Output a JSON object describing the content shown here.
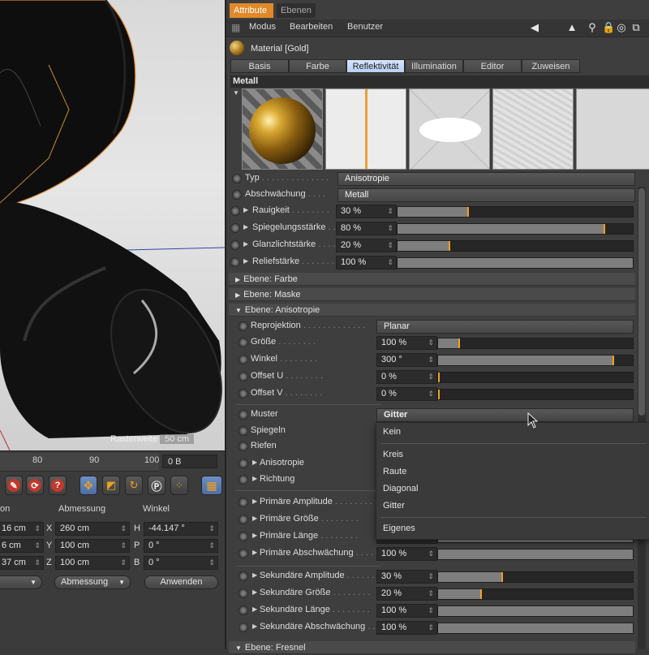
{
  "viewport": {
    "raster_label": "Rasterweite",
    "raster_value": "50 cm"
  },
  "timeline": {
    "ruler_ticks": [
      "80",
      "90",
      "100"
    ],
    "frame_value": "0 B"
  },
  "coords": {
    "headers": [
      "on",
      "Abmessung",
      "Winkel"
    ],
    "rows": [
      {
        "pos": "16 cm",
        "axis": "X",
        "size": "260 cm",
        "rot_label": "H",
        "rot": "-44.147 °"
      },
      {
        "pos": "6 cm",
        "axis": "Y",
        "size": "100 cm",
        "rot_label": "P",
        "rot": "0 °"
      },
      {
        "pos": "37 cm",
        "axis": "Z",
        "size": "100 cm",
        "rot_label": "B",
        "rot": "0 °"
      }
    ],
    "mode_dropdown": "Abmessung",
    "apply_label": "Anwenden"
  },
  "panel": {
    "tabs": [
      "Attribute",
      "Ebenen"
    ],
    "active_tab": 0,
    "menu": [
      "Modus",
      "Bearbeiten",
      "Benutzer"
    ],
    "material_title": "Material [Gold]",
    "subtabs": [
      "Basis",
      "Farbe",
      "Reflektivität",
      "Illumination",
      "Editor",
      "Zuweisen"
    ],
    "active_subtab": 2,
    "section_title": "Metall",
    "main_rows": [
      {
        "label": "Typ",
        "type": "drop",
        "value": "Anisotropie"
      },
      {
        "label": "Abschwächung",
        "type": "drop",
        "value": "Metall"
      },
      {
        "label": "Rauigkeit",
        "type": "slider",
        "value": "30 %",
        "level": 0.3
      },
      {
        "label": "Spiegelungsstärke",
        "type": "slider",
        "value": "80 %",
        "level": 0.88
      },
      {
        "label": "Glanzlichtstärke",
        "type": "slider",
        "value": "20 %",
        "level": 0.22
      },
      {
        "label": "Reliefstärke",
        "type": "slider",
        "value": "100 %",
        "level": 1.0
      }
    ],
    "groups": [
      "Ebene: Farbe",
      "Ebene: Maske",
      "Ebene: Anisotropie"
    ],
    "aniso_rows": [
      {
        "label": "Reprojektion",
        "type": "drop",
        "value": "Planar"
      },
      {
        "label": "Größe",
        "type": "slider",
        "value": "100 %",
        "level": 0.11
      },
      {
        "label": "Winkel",
        "type": "slider",
        "value": "300 °",
        "level": 0.9
      },
      {
        "label": "Offset U",
        "type": "slider",
        "value": "0 %",
        "level": 0.0
      },
      {
        "label": "Offset V",
        "type": "slider",
        "value": "0 %",
        "level": 0.0
      }
    ],
    "muster_label": "Muster",
    "muster_value": "Gitter",
    "pattern_rows": [
      "Spiegeln",
      "Riefen",
      "Anisotropie",
      "Richtung"
    ],
    "amp_rows": [
      {
        "label": "Primäre Amplitude",
        "value": "",
        "level": 0.0
      },
      {
        "label": "Primäre Größe",
        "value": "",
        "level": 0.0
      },
      {
        "label": "Primäre Länge",
        "value": "100 %",
        "level": 1.0
      },
      {
        "label": "Primäre Abschwächung",
        "value": "100 %",
        "level": 1.0
      }
    ],
    "sec_rows": [
      {
        "label": "Sekundäre Amplitude",
        "value": "30 %",
        "level": 0.33
      },
      {
        "label": "Sekundäre Größe",
        "value": "20 %",
        "level": 0.22
      },
      {
        "label": "Sekundäre Länge",
        "value": "100 %",
        "level": 1.0
      },
      {
        "label": "Sekundäre Abschwächung",
        "value": "100 %",
        "level": 1.0
      }
    ],
    "bottom_group": "Ebene: Fresnel"
  },
  "popup": {
    "items": [
      "Kein",
      "Kreis",
      "Raute",
      "Diagonal",
      "Gitter",
      "Eigenes"
    ]
  },
  "colors": {
    "accent_tab": "#e0892a",
    "slider_knob": "#f0a020",
    "active_subtab": "#c4d9f7"
  }
}
